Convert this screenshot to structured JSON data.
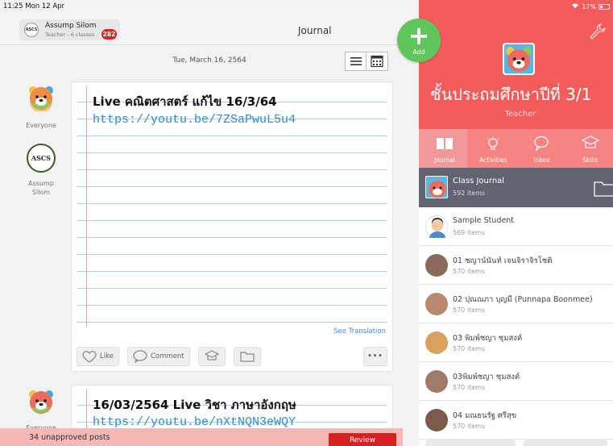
{
  "status": {
    "time": "11:25  Mon 12 Apr",
    "battery": "17%"
  },
  "header": {
    "school_name": "Assump Silom",
    "school_sub": "Teacher - 6 classes",
    "logo_text": "ASCS",
    "notif_count": "282",
    "title": "Journal"
  },
  "feed": {
    "date": "Tue, March 16, 2564",
    "posts": [
      {
        "title": "Live คณิตศาสตร์ แก้ไข 16/3/64",
        "link": "https://youtu.be/7ZSaPwuL5u4",
        "avatar_label_1": "Everyone",
        "avatar_label_2": "Assump\nSilom",
        "logo_text": "ASCS",
        "see_translation": "See Translation",
        "like_label": "Like",
        "comment_label": "Comment",
        "more_label": "•••"
      },
      {
        "title": "16/03/2564 Live วิชา ภาษาอังกฤษ",
        "link": "https://youtu.be/nXtNQN3eWQY",
        "avatar_label_1": "Everyone"
      }
    ]
  },
  "fab": {
    "label": "Add",
    "icon": "plus-icon"
  },
  "banner": {
    "text": "34 unapproved posts",
    "button": "Review"
  },
  "panel": {
    "class_name": "ชั้นประถมศึกษาปีที่ 3/1",
    "role": "Teacher",
    "tabs": [
      {
        "label": "Journal",
        "icon": "book-icon"
      },
      {
        "label": "Activities",
        "icon": "lightbulb-icon"
      },
      {
        "label": "Inbox",
        "icon": "chat-icon"
      },
      {
        "label": "Skills",
        "icon": "graduation-cap-icon"
      }
    ],
    "class_journal": {
      "title": "Class Journal",
      "sub": "592 items"
    },
    "students": [
      {
        "name": "Sample Student",
        "sub": "569 items",
        "color": "#f0c090"
      },
      {
        "name": "01 ชญาน์นันท์ เจนจิราจิรโชติ",
        "sub": "570 items",
        "color": "#8a6a5a"
      },
      {
        "name": "02 ปุณณภา  บุญมี (Punnapa  Boonmee)",
        "sub": "570 items",
        "color": "#b88a70"
      },
      {
        "name": "03 พิมพ์ชญา ชุมสงค์",
        "sub": "570 items",
        "color": "#d9a060"
      },
      {
        "name": "03พิมพ์ชญา ชุมสงค์",
        "sub": "570 items",
        "color": "#a07a6a"
      },
      {
        "name": "04 มณธนรัฐ ศรีสุข",
        "sub": "570 items",
        "color": "#7a5a4a"
      }
    ]
  },
  "colors": {
    "brand": "#f25c5c",
    "fab": "#5ec65a",
    "link": "#2b8bd6",
    "review": "#d72020"
  }
}
